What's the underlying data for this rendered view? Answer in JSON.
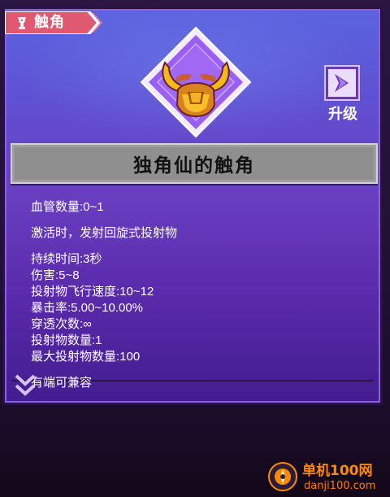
{
  "header": {
    "tag_label": "触角"
  },
  "actions": {
    "upgrade_label": "升级"
  },
  "item": {
    "name": "独角仙的触角",
    "icon": "horned-helmet-icon"
  },
  "stats": {
    "blood_vessel": "血管数量:0~1",
    "activation": "激活时，发射回旋式投射物",
    "duration": "持续时间:3秒",
    "damage": "伤害:5~8",
    "speed": "投射物飞行速度:10~12",
    "crit": "暴击率:5.00~10.00%",
    "pierce": "穿透次数:∞",
    "count": "投射物数量:1",
    "max_count": "最大投射物数量:100",
    "partial_line": "有端可兼容"
  },
  "watermark": {
    "title": "单机100网",
    "url": "danji100.com"
  },
  "colors": {
    "tag_bg": "#e15970",
    "accent": "#7b45d1",
    "diamond_bg": "#9a5ef2",
    "name_bar": "#8f8f8f",
    "watermark": "#ff8a00"
  }
}
